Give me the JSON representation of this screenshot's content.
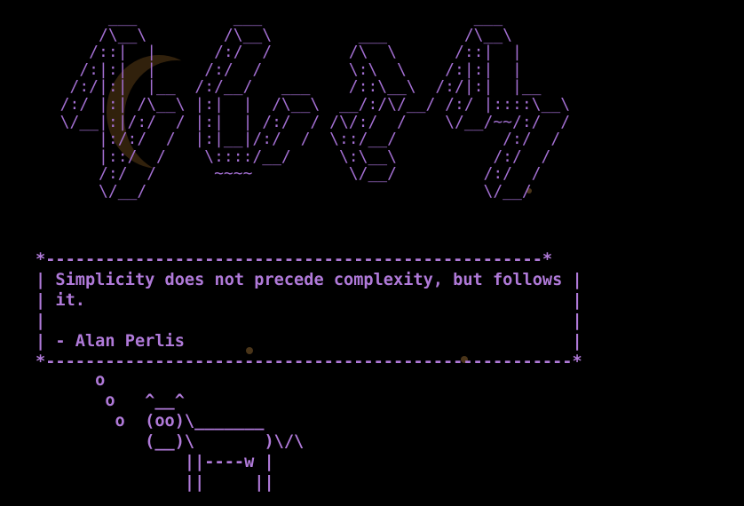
{
  "terminal": {
    "banner_art": "       ___          ___                      ___\n      /\\__\\        /\\__\\         ___        /\\__\\\n     /::|  |      /:/  /        /\\  \\      /::|  |\n    /:|:|  |     /:/  /         \\:\\  \\    /:|:|  |\n   /:/|:|  |__  /:/__/   ___    /::\\__\\  /:/|:|  |__\n  /:/ |:| /\\__\\ |:|  |  /\\__\\  __/:/\\/__/ /:/ |::::\\__\\\n  \\/__|:|/:/  / |:|  | /:/  / /\\/:/  /    \\/__/~~/:/  /\n      |:/:/  /  |:|__|/:/  /  \\::/__/           /:/  /\n      |::/  /    \\::::/__/     \\:\\__\\          /:/  /\n      /:/  /      ~~~~          \\/__/         /:/  /\n      \\/__/                                   \\/__/",
    "quote_box": "*--------------------------------------------------*\n| Simplicity does not precede complexity, but follows |\n| it.                                                 |\n|                                                     |\n| - Alan Perlis                                       |\n*-----------------------------------------------------*",
    "cow_art": "      o\n       o   ^__^\n        o  (oo)\\_______\n           (__)\\       )\\/\\\n               ||----w |\n               ||     ||",
    "colors": {
      "background": "#000000",
      "text": "#b07ad9",
      "accent_moon": "#5a3c17"
    }
  }
}
